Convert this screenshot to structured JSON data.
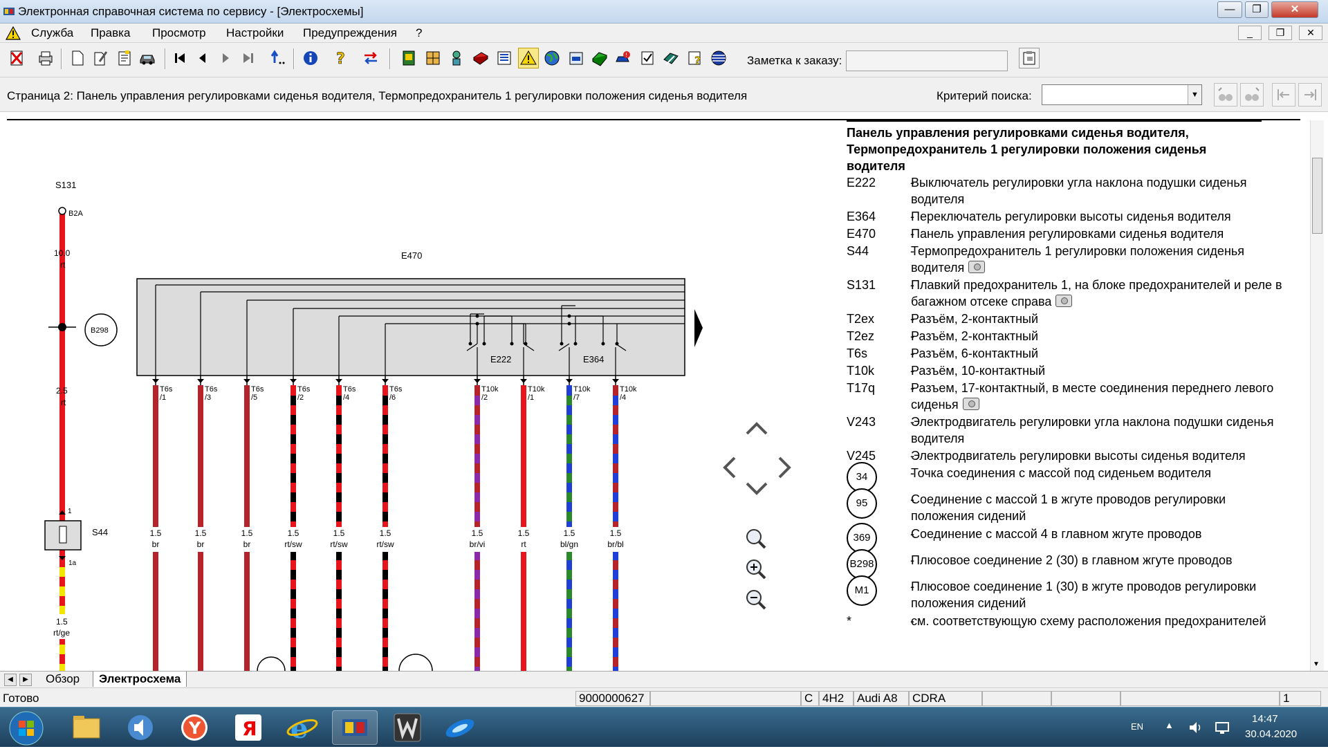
{
  "window": {
    "title": "Электронная справочная система по сервису - [Электросхемы]"
  },
  "menu": {
    "items": [
      "Служба",
      "Правка",
      "Просмотр",
      "Настройки",
      "Предупреждения",
      "?"
    ]
  },
  "toolbar": {
    "note_label": "Заметка к заказу:",
    "note_value": ""
  },
  "pagebar": {
    "page_title": "Страница 2: Панель управления регулировками сиденья водителя, Термопредохранитель 1 регулировки положения сиденья водителя",
    "search_label": "Критерий поиска:",
    "search_value": ""
  },
  "diagram": {
    "labels": {
      "s131": "S131",
      "b2a": "B2A",
      "w1_size": "10.0",
      "w1_color": "rt",
      "b298": "B298",
      "w2_size": "2.5",
      "w2_color": "rt",
      "e470": "E470",
      "e222": "E222",
      "e364": "E364",
      "s44": "S44",
      "s44_pin1": "1",
      "s44_pin1a": "1a",
      "w3_size": "1.5",
      "w3_color": "rt/ge"
    },
    "connectors": [
      {
        "top": "T6s",
        "pin": "/1",
        "size": "1.5",
        "color": "br"
      },
      {
        "top": "T6s",
        "pin": "/3",
        "size": "1.5",
        "color": "br"
      },
      {
        "top": "T6s",
        "pin": "/5",
        "size": "1.5",
        "color": "br"
      },
      {
        "top": "T6s",
        "pin": "/2",
        "size": "1.5",
        "color": "rt/sw"
      },
      {
        "top": "T6s",
        "pin": "/4",
        "size": "1.5",
        "color": "rt/sw"
      },
      {
        "top": "T6s",
        "pin": "/6",
        "size": "1.5",
        "color": "rt/sw"
      },
      {
        "top": "T10k",
        "pin": "/2",
        "size": "1.5",
        "color": "br/vi"
      },
      {
        "top": "T10k",
        "pin": "/1",
        "size": "1.5",
        "color": "rt"
      },
      {
        "top": "T10k",
        "pin": "/7",
        "size": "1.5",
        "color": "bl/gn"
      },
      {
        "top": "T10k",
        "pin": "/4",
        "size": "1.5",
        "color": "br/bl"
      }
    ]
  },
  "legend": {
    "title": "Панель управления регулировками сиденья водителя, Термопредохранитель 1 регулировки положения сиденья водителя",
    "items": [
      {
        "code": "E222",
        "desc": "Выключатель регулировки угла наклона подушки сиденья водителя"
      },
      {
        "code": "E364",
        "desc": "Переключатель регулировки высоты сиденья водителя"
      },
      {
        "code": "E470",
        "desc": "Панель управления регулировками сиденья водителя"
      },
      {
        "code": "S44",
        "desc": "Термопредохранитель 1 регулировки положения сиденья водителя"
      },
      {
        "code": "S131",
        "desc": "Плавкий предохранитель 1, на блоке предохранителей и реле в багажном отсеке справа"
      },
      {
        "code": "T2ex",
        "desc": "Разъём, 2-контактный"
      },
      {
        "code": "T2ez",
        "desc": "Разъём, 2-контактный"
      },
      {
        "code": "T6s",
        "desc": "Разъём, 6-контактный"
      },
      {
        "code": "T10k",
        "desc": "Разъём, 10-контактный"
      },
      {
        "code": "T17q",
        "desc": "Разъем, 17-контактный, в месте соединения переднего левого сиденья"
      },
      {
        "code": "V243",
        "desc": "Электродвигатель регулировки угла наклона подушки сиденья водителя"
      },
      {
        "code": "V245",
        "desc": "Электродвигатель регулировки высоты сиденья водителя"
      },
      {
        "code": "34",
        "desc": "Точка соединения с массой под сиденьем водителя"
      },
      {
        "code": "95",
        "desc": "Соединение с массой 1 в жгуте проводов регулировки положения сидений"
      },
      {
        "code": "369",
        "desc": "Соединение с массой 4 в главном жгуте проводов"
      },
      {
        "code": "B298",
        "desc": "Плюсовое соединение 2 (30) в главном жгуте проводов"
      },
      {
        "code": "M1",
        "desc": "Плюсовое соединение 1 (30) в жгуте проводов регулировки положения сидений"
      },
      {
        "code": "*",
        "desc": "см. соответствующую схему расположения предохранителей"
      }
    ]
  },
  "tabs": {
    "overview": "Обзор",
    "schematic": "Электросхема"
  },
  "status": {
    "ready": "Готово",
    "order": "9000000627",
    "c": "C",
    "model_code": "4H2",
    "model": "Audi A8",
    "engine": "CDRA",
    "page": "1"
  },
  "taskbar": {
    "lang": "EN",
    "time": "14:47",
    "date": "30.04.2020"
  },
  "colors": {
    "wire_red": "#e8141c",
    "wire_brown": "#b5242a",
    "wire_black": "#000000",
    "wire_purple": "#8b2aa6",
    "wire_blue": "#1f3fd6",
    "wire_green": "#2a8a2a",
    "wire_yellow": "#f2e600"
  }
}
